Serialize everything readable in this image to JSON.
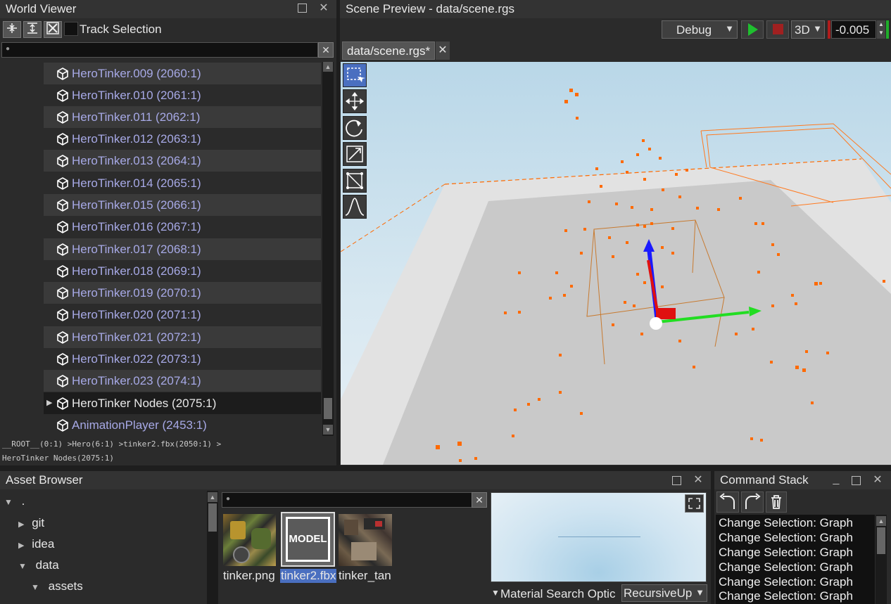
{
  "world_viewer": {
    "title": "World Viewer",
    "track_selection_label": "Track Selection",
    "search_placeholder": "",
    "items": [
      {
        "label": "HeroTinker.009 (2060:1)"
      },
      {
        "label": "HeroTinker.010 (2061:1)"
      },
      {
        "label": "HeroTinker.011 (2062:1)"
      },
      {
        "label": "HeroTinker.012 (2063:1)"
      },
      {
        "label": "HeroTinker.013 (2064:1)"
      },
      {
        "label": "HeroTinker.014 (2065:1)"
      },
      {
        "label": "HeroTinker.015 (2066:1)"
      },
      {
        "label": "HeroTinker.016 (2067:1)"
      },
      {
        "label": "HeroTinker.017 (2068:1)"
      },
      {
        "label": "HeroTinker.018 (2069:1)"
      },
      {
        "label": "HeroTinker.019 (2070:1)"
      },
      {
        "label": "HeroTinker.020 (2071:1)"
      },
      {
        "label": "HeroTinker.021 (2072:1)"
      },
      {
        "label": "HeroTinker.022 (2073:1)"
      },
      {
        "label": "HeroTinker.023 (2074:1)"
      },
      {
        "label": "HeroTinker Nodes (2075:1)"
      },
      {
        "label": "AnimationPlayer (2453:1)"
      }
    ],
    "path_line1": "__ROOT__(0:1) >Hero(6:1) >tinker2.fbx(2050:1) >",
    "path_line2": "HeroTinker Nodes(2075:1)"
  },
  "scene_preview": {
    "title": "Scene Preview - data/scene.rgs",
    "config_select": "Debug",
    "view_mode": "3D",
    "value_field": "-0.005",
    "tab_label": "data/scene.rgs*",
    "tools": [
      "select-tool-icon",
      "move-tool-icon",
      "rotate-tool-icon",
      "scale-tool-icon",
      "rect-tool-icon",
      "curve-tool-icon"
    ]
  },
  "asset_browser": {
    "title": "Asset Browser",
    "tree": [
      {
        "label": "."
      },
      {
        "label": "git"
      },
      {
        "label": "idea"
      },
      {
        "label": "data"
      },
      {
        "label": "assets"
      }
    ],
    "search_placeholder": "",
    "files": [
      {
        "label": "tinker.png"
      },
      {
        "label": "tinker2.fbx",
        "thumb_text": "MODEL"
      },
      {
        "label": "tinker_tan"
      }
    ],
    "material_search_label": "Material Search Optic",
    "material_search_value": "RecursiveUp"
  },
  "command_stack": {
    "title": "Command Stack",
    "entries": [
      "Change Selection: Graph",
      "Change Selection: Graph",
      "Change Selection: Graph",
      "Change Selection: Graph",
      "Change Selection: Graph",
      "Change Selection: Graph"
    ]
  },
  "colors": {
    "accent": "#4a6fc0",
    "tree_text": "#a7a9e6",
    "play_green": "#1fbf2f",
    "stop_red": "#a02020",
    "gizmo_blue": "#1a1aff",
    "gizmo_green": "#22dd22",
    "gizmo_red": "#e01010",
    "particle_orange": "#ff6a00"
  }
}
